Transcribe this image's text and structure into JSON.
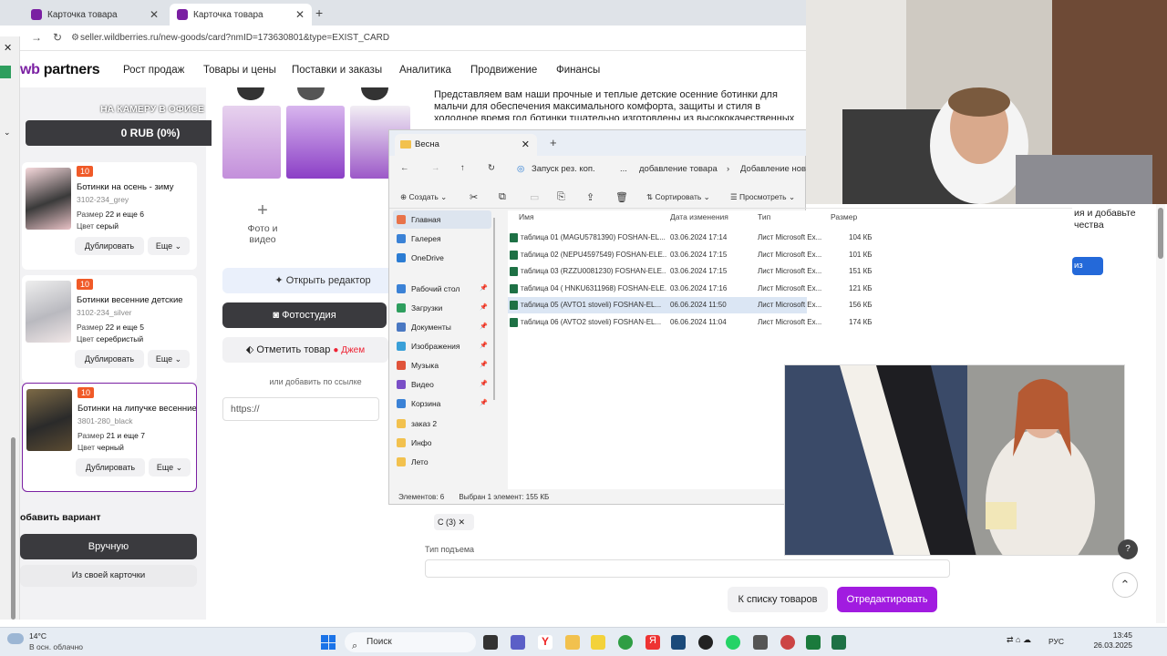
{
  "browser": {
    "tabs": [
      {
        "label": "Карточка товара"
      },
      {
        "label": "Карточка товара"
      }
    ],
    "new_tab": "+",
    "url": "seller.wildberries.ru/new-goods/card?nmID=173630801&type=EXIST_CARD"
  },
  "wb": {
    "logo_wb": "wb",
    "logo_partners": "partners",
    "nav": [
      "Рост продаж",
      "Товары и цены",
      "Поставки и заказы",
      "Аналитика",
      "Продвижение",
      "Финансы"
    ]
  },
  "overlay": {
    "banner": "НА КАМЕРУ В ОФИСЕ",
    "rub": "0 RUB (0%)"
  },
  "products": [
    {
      "badge": "10",
      "title": "Ботинки на осень - зиму",
      "sku": "3102-234_grey",
      "size_label": "Размер",
      "size_value": "22 и еще 6",
      "color_label": "Цвет",
      "color_value": "серый",
      "dup": "Дублировать",
      "more": "Еще"
    },
    {
      "badge": "10",
      "title": "Ботинки весенние детские",
      "sku": "3102-234_silver",
      "size_label": "Размер",
      "size_value": "22 и еще 5",
      "color_label": "Цвет",
      "color_value": "серебристый",
      "dup": "Дублировать",
      "more": "Еще"
    },
    {
      "badge": "10",
      "title": "Ботинки на липучке весенние",
      "sku": "3801-280_black",
      "size_label": "Размер",
      "size_value": "21 и еще 7",
      "color_label": "Цвет",
      "color_value": "черный",
      "dup": "Дублировать",
      "more": "Еще"
    }
  ],
  "variant": {
    "add_label": "обавить вариант",
    "manual": "Вручную",
    "from_card": "Из своей карточки"
  },
  "media": {
    "photo_video": "Фото и видео",
    "open_editor": "Открыть редактор",
    "photostudio": "Фотостудия",
    "mark_product": "Отметить товар",
    "djem": "Джем",
    "or_link": "или добавить по ссылке",
    "url_placeholder": "https://"
  },
  "description": "Представляем вам наши прочные и теплые детские осенние ботинки для мальчи для обеспечения максимального комфорта, защиты и стиля в холодное время год ботинки тщательно изготовлены из высококачественных материалов, что делает",
  "explorer": {
    "tab_title": "Весна",
    "breadcrumb": [
      "Запуск рез. коп.",
      "...",
      "добавление товара",
      "Добавление нов"
    ],
    "toolbar": {
      "create": "Создать",
      "sort": "Сортировать",
      "view": "Просмотреть"
    },
    "nav": [
      {
        "label": "Главная",
        "color": "#e8734a"
      },
      {
        "label": "Галерея",
        "color": "#3b82d6"
      },
      {
        "label": "OneDrive",
        "color": "#2b7cd3"
      },
      {
        "label": "Рабочий стол",
        "color": "#3b82d6"
      },
      {
        "label": "Загрузки",
        "color": "#2e9e5e"
      },
      {
        "label": "Документы",
        "color": "#4a78c2"
      },
      {
        "label": "Изображения",
        "color": "#3aa0d8"
      },
      {
        "label": "Музыка",
        "color": "#e0533a"
      },
      {
        "label": "Видео",
        "color": "#7a4fc7"
      },
      {
        "label": "Корзина",
        "color": "#3b82d6"
      },
      {
        "label": "заказ 2",
        "color": "#f2c14e"
      },
      {
        "label": "Инфо",
        "color": "#f2c14e"
      },
      {
        "label": "Лето",
        "color": "#f2c14e"
      }
    ],
    "columns": [
      "Имя",
      "Дата изменения",
      "Тип",
      "Размер"
    ],
    "files": [
      {
        "name": "таблица 01 (MAGU5781390) FOSHAN-EL...",
        "date": "03.06.2024 17:14",
        "type": "Лист Microsoft Ex...",
        "size": "104 КБ"
      },
      {
        "name": "таблица 02 (NEPU4597549) FOSHAN-ELE...",
        "date": "03.06.2024 17:15",
        "type": "Лист Microsoft Ex...",
        "size": "101 КБ"
      },
      {
        "name": "таблица 03 (RZZU0081230) FOSHAN-ELE...",
        "date": "03.06.2024 17:15",
        "type": "Лист Microsoft Ex...",
        "size": "151 КБ"
      },
      {
        "name": "таблица 04 ( HNKU6311968) FOSHAN-ELE...",
        "date": "03.06.2024 17:16",
        "type": "Лист Microsoft Ex...",
        "size": "121 КБ"
      },
      {
        "name": "таблица 05 (AVTO1 stoveli) FOSHAN-EL...",
        "date": "06.06.2024 11:50",
        "type": "Лист Microsoft Ex...",
        "size": "156 КБ"
      },
      {
        "name": "таблица 06 (AVTO2 stoveli) FOSHAN-EL...",
        "date": "06.06.2024 11:04",
        "type": "Лист Microsoft Ex...",
        "size": "174 КБ"
      }
    ],
    "status_items": "Элементов: 6",
    "status_selected": "Выбран 1 элемент: 155 КБ"
  },
  "right_panel": {
    "text": "ия и добавьте чества",
    "button": "из"
  },
  "form": {
    "chip": "С (3)",
    "lift_label": "Тип подъема",
    "to_list": "К списку товаров",
    "edit": "Отредактировать"
  },
  "taskbar": {
    "temp": "14°C",
    "weather": "В осн. облачно",
    "search": "Поиск",
    "lang": "РУС",
    "time": "13:45",
    "date": "26.03.2025"
  }
}
